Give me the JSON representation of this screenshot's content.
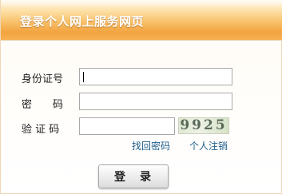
{
  "header": {
    "title": "登录个人网上服务网页"
  },
  "form": {
    "id_label": "身份证号",
    "id_value": "",
    "password_label": "密　　码",
    "password_value": "",
    "captcha_label": "验 证 码",
    "captcha_value": "",
    "captcha_image_text": "9925"
  },
  "links": {
    "recover_password": "找回密码",
    "personal_logout": "个人注销"
  },
  "actions": {
    "login_label": "登　录"
  },
  "colors": {
    "header_gradient_top": "#fff4e0",
    "header_gradient_bottom": "#f2a440",
    "link": "#1f5e8c"
  }
}
